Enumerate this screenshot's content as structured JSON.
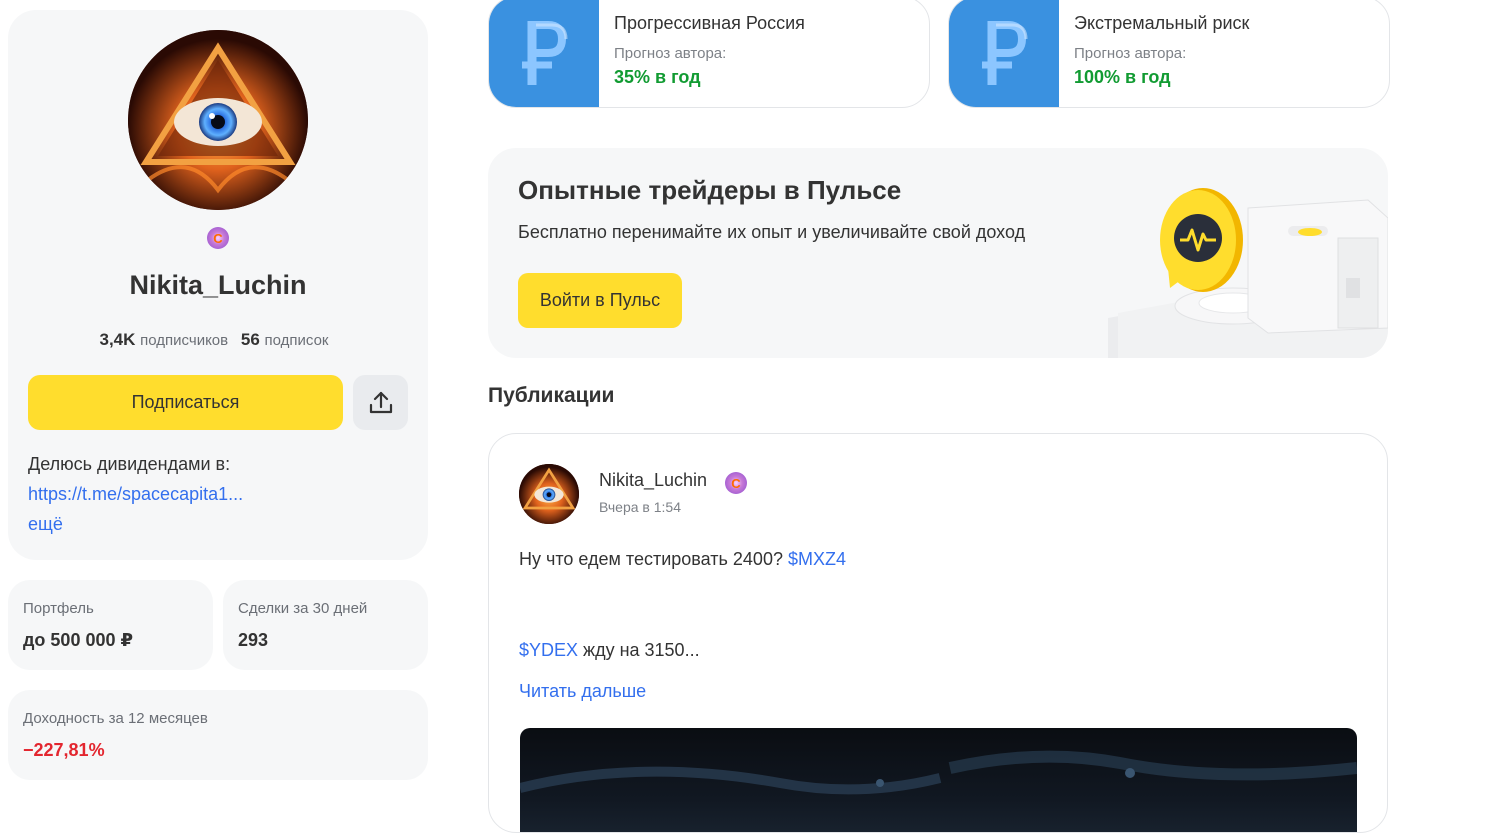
{
  "profile": {
    "name": "Nikita_Luchin",
    "followers_count": "3,4K",
    "followers_label": "подписчиков",
    "following_count": "56",
    "following_label": "подписок",
    "subscribe_label": "Подписаться",
    "bio_text": "Делюсь дивидендами в:",
    "bio_link": "https://t.me/spacecapita1...",
    "bio_more": "ещё"
  },
  "stats": {
    "portfolio_label": "Портфель",
    "portfolio_value": "до 500 000 ₽",
    "deals_label": "Сделки за 30 дней",
    "deals_value": "293",
    "yield_label": "Доходность за 12 месяцев",
    "yield_value": "−227,81%"
  },
  "strategies": [
    {
      "title": "Прогрессивная Россия",
      "forecast_label": "Прогноз автора:",
      "forecast_value": "35% в год"
    },
    {
      "title": "Экстремальный риск",
      "forecast_label": "Прогноз автора:",
      "forecast_value": "100% в год"
    }
  ],
  "promo": {
    "title": "Опытные трейдеры в Пульсе",
    "subtitle": "Бесплатно перенимайте их опыт и увеличивайте свой доход",
    "button_label": "Войти в Пульс"
  },
  "publications": {
    "section_title": "Публикации",
    "post": {
      "author": "Nikita_Luchin",
      "time": "Вчера в 1:54",
      "line1_text": "Ну что едем тестировать 2400? ",
      "line1_ticker": "$MXZ4",
      "line2_ticker": "$YDEX",
      "line2_text": " жду на 3150...",
      "read_more": "Читать дальше"
    }
  },
  "colors": {
    "accent_yellow": "#ffdd2d",
    "link_blue": "#336fee",
    "positive_green": "#119b32",
    "negative_red": "#e3262f",
    "strategy_blue": "#3a91e0",
    "card_gray": "#f6f7f8"
  }
}
